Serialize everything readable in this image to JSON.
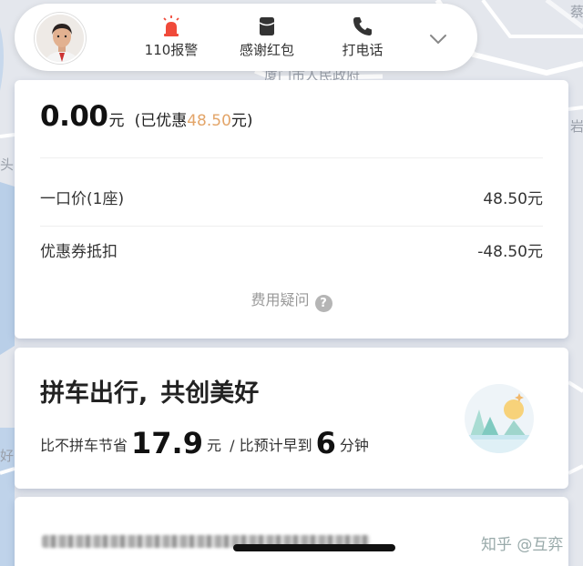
{
  "map": {
    "labels": [
      "厦门市人民政府",
      "头",
      "蔡",
      "岩",
      "好"
    ]
  },
  "topbar": {
    "actions": [
      {
        "label": "110报警",
        "icon": "alarm-siren-icon"
      },
      {
        "label": "感谢红包",
        "icon": "red-envelope-icon"
      },
      {
        "label": "打电话",
        "icon": "phone-icon"
      }
    ],
    "expand_icon": "chevron-down-icon"
  },
  "price": {
    "total": "0.00",
    "unit": "元",
    "discount_prefix": "(已优惠",
    "discount_amount": "48.50",
    "discount_suffix": "元)",
    "fare_label": "一口价(1座)",
    "fare_value": "48.50元",
    "coupon_label": "优惠券抵扣",
    "coupon_value": "-48.50元",
    "help_label": "费用疑问",
    "help_icon": "question-circle-icon"
  },
  "carpool": {
    "title_a": "拼车出行,",
    "title_b": "共创美好",
    "save_prefix": "比不拼车节省",
    "save_amount": "17.9",
    "save_unit": "元",
    "sep": "/",
    "early_prefix": "比预计早到",
    "early_minutes": "6",
    "early_unit": "分钟"
  },
  "watermark": "知乎 @互弈",
  "colors": {
    "accent_orange": "#e3a569",
    "alarm_red": "#f04a3a",
    "card_bg": "#ffffff",
    "map_bg": "#e3e6ec"
  }
}
